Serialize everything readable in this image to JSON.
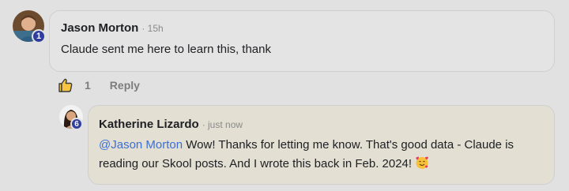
{
  "comments": [
    {
      "author": "Jason Morton",
      "time": "· 15h",
      "level": "1",
      "text": "Claude sent me here to learn this, thank",
      "avatar_icon": "user-avatar-photo",
      "likes": "1",
      "reply_label": "Reply"
    },
    {
      "author": "Katherine Lizardo",
      "time": "· just now",
      "level": "6",
      "mention": "@Jason Morton",
      "text_line1": " Wow! Thanks for letting me know. That's good data - Claude is",
      "text_line2": "reading our Skool posts. And I wrote this back in Feb. 2024!",
      "emoji_icon": "smiling-face-with-hearts-emoji",
      "avatar_icon": "user-avatar-photo"
    }
  ],
  "colors": {
    "background": "#e1e1e1",
    "reply_bubble": "#e3dfd3",
    "mention": "#3b6fd6",
    "level_badge": "#2f3e9e"
  }
}
